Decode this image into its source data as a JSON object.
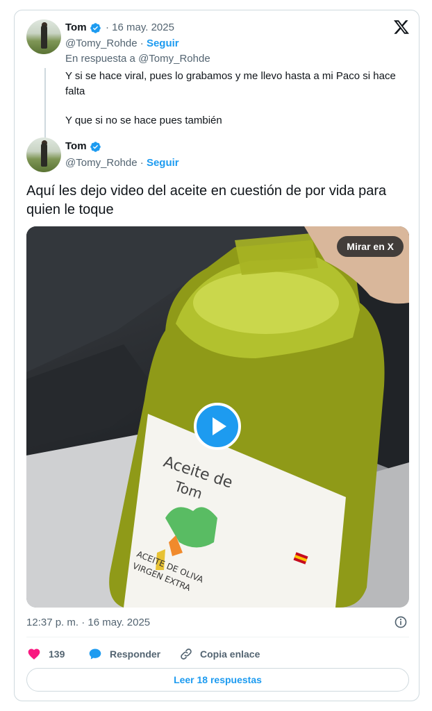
{
  "reply_tweet": {
    "author_name": "Tom",
    "date": "· 16 may. 2025",
    "handle": "@Tomy_Rohde ·",
    "follow_label": "Seguir",
    "replying_to": "En respuesta a @Tomy_Rohde",
    "text_line1": "Y si se hace viral, pues lo grabamos y me llevo hasta a mi Paco si hace",
    "text_line2": "falta",
    "text_line3": "Y que si no se hace pues también"
  },
  "main_tweet": {
    "author_name": "Tom",
    "handle": "@Tomy_Rohde ·",
    "follow_label": "Seguir",
    "text": "Aquí les dejo video del aceite en cuestión de por vida para quien le toque",
    "watch_on_x": "Mirar en X",
    "timestamp": "12:37 p. m. · 16 may. 2025"
  },
  "bottle_label": {
    "handwritten_line1": "Aceite de",
    "handwritten_line2": "Tom",
    "printed_line1": "ACEITE DE OLIVA",
    "printed_line2": "VIRGEN EXTRA"
  },
  "actions": {
    "likes_count": "139",
    "reply_label": "Responder",
    "copy_link_label": "Copia enlace",
    "read_replies_label": "Leer 18 respuestas"
  },
  "icons": [
    "x-logo-icon",
    "verified-badge-icon",
    "play-icon",
    "info-icon",
    "heart-icon",
    "reply-bubble-icon",
    "link-icon"
  ],
  "colors": {
    "accent": "#1d9bf0",
    "like": "#f91880",
    "secondary_text": "#536471"
  }
}
